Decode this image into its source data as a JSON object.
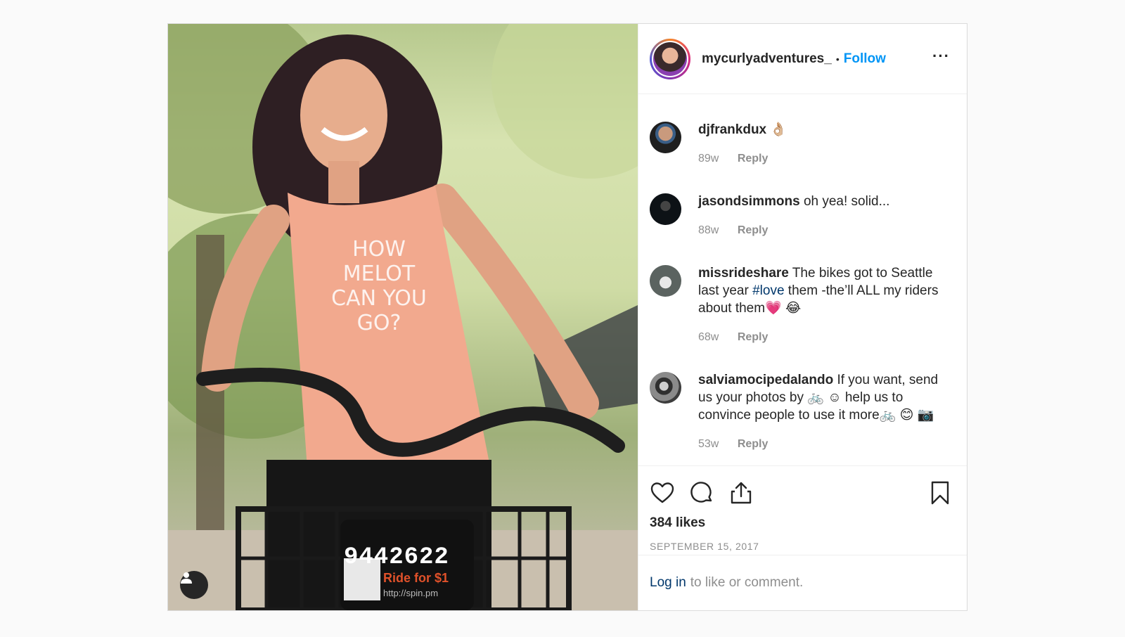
{
  "header": {
    "username": "mycurlyadventures_",
    "separator": "•",
    "follow_label": "Follow",
    "more_label": "···"
  },
  "photo": {
    "bike_number": "9442622",
    "plate_text": "Ride for $1",
    "plate_url": "http://spin.pm",
    "shirt_text": "HOW MELOT CAN YOU GO?"
  },
  "comments": [
    {
      "username": "djfrankdux",
      "text": "👌🏼",
      "age": "89w",
      "reply_label": "Reply",
      "avatar_color": "#5a6b74"
    },
    {
      "username": "jasondsimmons",
      "text": "oh yea! solid...",
      "age": "88w",
      "reply_label": "Reply",
      "avatar_color": "#1d2328"
    },
    {
      "username": "missrideshare",
      "text_pre": "The bikes got to Seattle last year ",
      "hashtag": "#love",
      "text_post": " them -the’ll ALL my riders about them💗 😂",
      "age": "68w",
      "reply_label": "Reply",
      "avatar_color": "#6f7773"
    },
    {
      "username": "salviamocipedalando",
      "text": "If you want, send us your photos by 🚲 ☺ help us to convince people to use it more🚲 😊 📷",
      "age": "53w",
      "reply_label": "Reply",
      "avatar_color": "#4a4a4a"
    }
  ],
  "actions": {
    "likes": "384 likes",
    "date": "SEPTEMBER 15, 2017"
  },
  "login": {
    "link_label": "Log in",
    "rest_label": "to like or comment."
  }
}
